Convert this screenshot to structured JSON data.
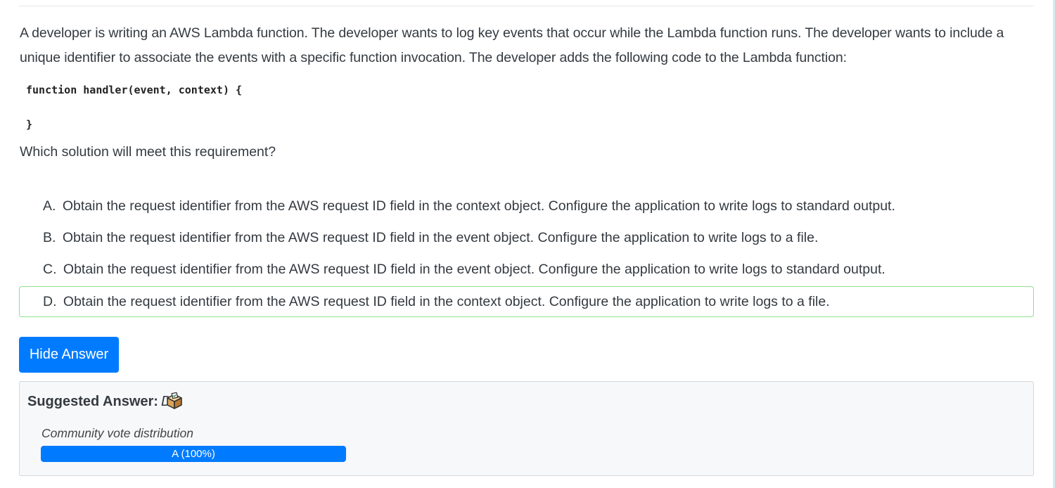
{
  "question": {
    "text": "A developer is writing an AWS Lambda function. The developer wants to log key events that occur while the Lambda function runs. The developer wants to include a unique identifier to associate the events with a specific function invocation. The developer adds the following code to the Lambda function:",
    "code_line_1": "function handler(event, context) {",
    "code_line_2": "}",
    "prompt": "Which solution will meet this requirement?"
  },
  "choices": [
    {
      "letter": "A.",
      "text": "Obtain the request identifier from the AWS request ID field in the context object. Configure the application to write logs to standard output."
    },
    {
      "letter": "B.",
      "text": "Obtain the request identifier from the AWS request ID field in the event object. Configure the application to write logs to a file."
    },
    {
      "letter": "C.",
      "text": "Obtain the request identifier from the AWS request ID field in the event object. Configure the application to write logs to standard output."
    },
    {
      "letter": "D.",
      "text": "Obtain the request identifier from the AWS request ID field in the context object. Configure the application to write logs to a file."
    }
  ],
  "highlighted_choice": "D",
  "hide_button_label": "Hide Answer",
  "answer": {
    "label": "Suggested Answer:",
    "value": "D",
    "icon": "ballot-box-icon",
    "distribution_label": "Community vote distribution",
    "vote_bar": {
      "text": "A (100%)",
      "fraction": 1.0,
      "color": "#007bff"
    }
  },
  "colors": {
    "accent": "#007bff",
    "correct_border": "#8ee08e",
    "text": "#343a40"
  }
}
